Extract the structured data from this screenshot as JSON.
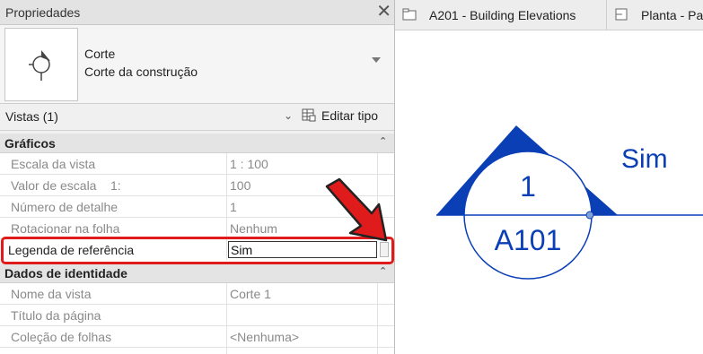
{
  "properties": {
    "title": "Propriedades",
    "close_icon": "close-icon",
    "type": {
      "name": "Corte",
      "subtype": "Corte da construção"
    },
    "views_selector": "Vistas (1)",
    "edit_type_label": "Editar tipo",
    "groups": {
      "graphics": {
        "label": "Gráficos",
        "rows": [
          {
            "key": "Escala da vista",
            "value": "1 : 100"
          },
          {
            "key": "Valor de escala    1:",
            "value": "100"
          },
          {
            "key": "Número de detalhe",
            "value": "1"
          },
          {
            "key": "Rotacionar na folha",
            "value": "Nenhum"
          }
        ],
        "active_row": {
          "key": "Legenda de referência",
          "value": "Sim"
        }
      },
      "identity": {
        "label": "Dados de identidade",
        "rows": [
          {
            "key": "Nome da vista",
            "value": "Corte 1"
          },
          {
            "key": "Título da página",
            "value": ""
          },
          {
            "key": "Coleção de folhas",
            "value": "<Nenhuma>"
          }
        ]
      }
    }
  },
  "tabs": [
    {
      "label": "A201 - Building Elevations",
      "icon": "elevation-view-icon"
    },
    {
      "label": "Planta - Pa",
      "icon": "floor-plan-icon"
    }
  ],
  "section_marker": {
    "detail_number": "1",
    "sheet_number": "A101",
    "tag_text": "Sim",
    "color": "#0a3fb5"
  },
  "colors": {
    "highlight": "#e01b1b"
  }
}
